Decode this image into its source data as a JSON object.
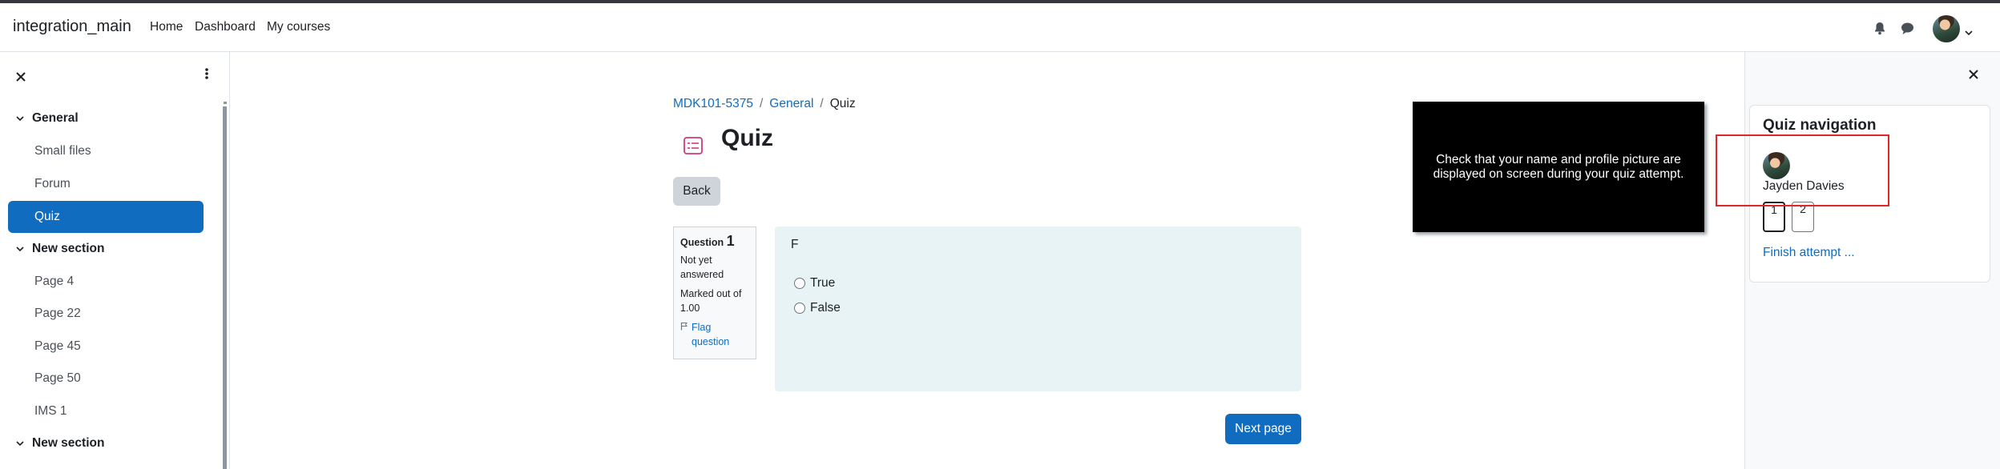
{
  "navbar": {
    "brand": "integration_main",
    "links": [
      "Home",
      "Dashboard",
      "My courses"
    ],
    "icons": [
      "bell-icon",
      "chat-icon"
    ]
  },
  "drawer": {
    "close_icon": "close-icon",
    "menu_icon": "kebab-icon",
    "sections": [
      {
        "title": "General",
        "items": [
          "Small files",
          "Forum",
          "Quiz"
        ]
      },
      {
        "title": "New section",
        "items": [
          "Page 4",
          "Page 22",
          "Page 45",
          "Page 50",
          "IMS 1"
        ]
      },
      {
        "title": "New section",
        "items": []
      }
    ],
    "active_item": "Quiz"
  },
  "breadcrumb": [
    "MDK101-5375",
    "General",
    "Quiz"
  ],
  "page": {
    "title": "Quiz",
    "back_label": "Back",
    "next_label": "Next page"
  },
  "question": {
    "label": "Question",
    "number": "1",
    "status": "Not yet answered",
    "marked": "Marked out of 1.00",
    "flag": "Flag question",
    "text": "F",
    "options": [
      "True",
      "False"
    ]
  },
  "proctor": {
    "message": "Check that your name and profile picture are displayed on screen during your quiz attempt."
  },
  "quiz_nav": {
    "title": "Quiz navigation",
    "user": "Jayden Davies",
    "buttons": [
      "1",
      "2"
    ],
    "current": "1",
    "finish": "Finish attempt ..."
  },
  "colors": {
    "primary": "#0f6cbf",
    "highlight": "#e0262a",
    "question_bg": "#e7f3f5"
  }
}
